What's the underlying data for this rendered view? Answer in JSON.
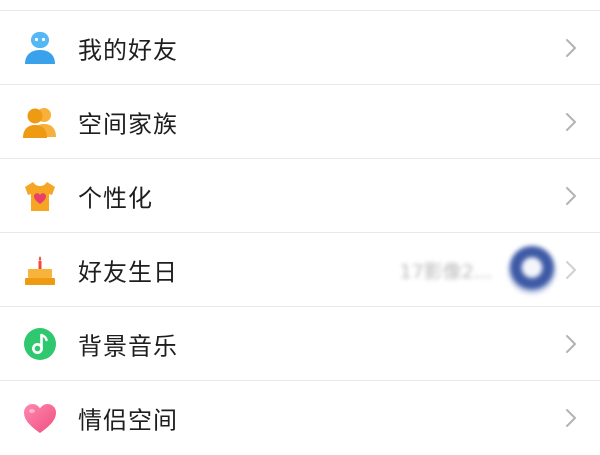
{
  "menu": {
    "items": [
      {
        "label": "我的好友",
        "icon": "friends-person-icon",
        "color": "#4fb3f2"
      },
      {
        "label": "空间家族",
        "icon": "family-group-icon",
        "color": "#f4a31d"
      },
      {
        "label": "个性化",
        "icon": "tshirt-heart-icon",
        "color": "#f5a623"
      },
      {
        "label": "好友生日",
        "icon": "birthday-cake-icon",
        "color": "#f29f1c",
        "extra_text": "17影像2..."
      },
      {
        "label": "背景音乐",
        "icon": "music-note-icon",
        "color": "#2fc86e"
      },
      {
        "label": "情侣空间",
        "icon": "heart-icon",
        "color": "#f25c91"
      }
    ]
  }
}
